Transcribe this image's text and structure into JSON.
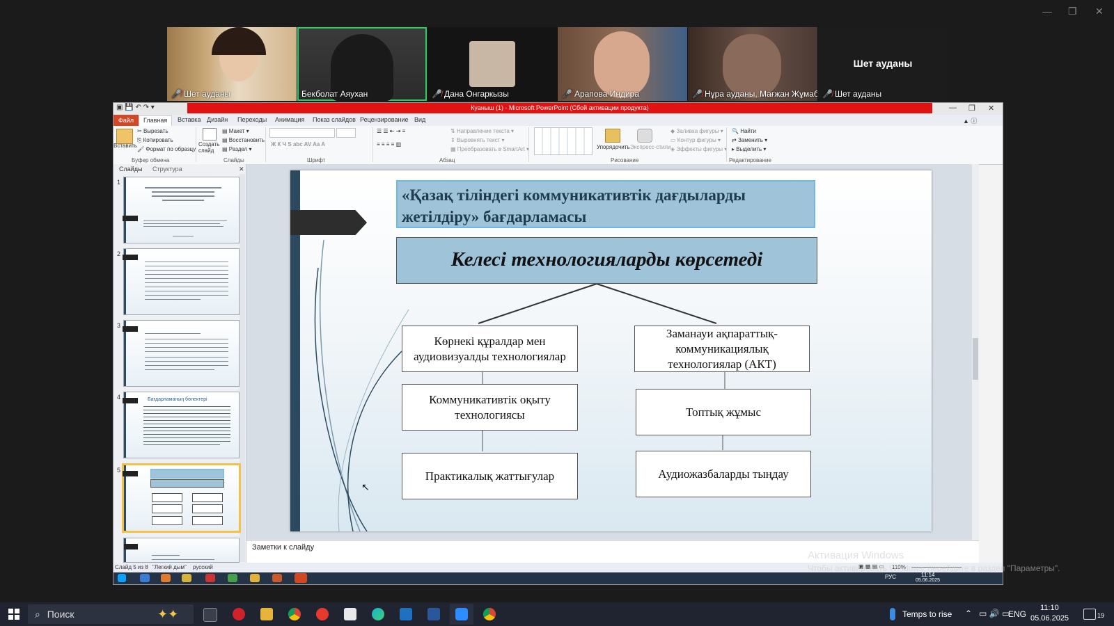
{
  "zoom_strip": {
    "participants": [
      {
        "name": "Шет ауданы",
        "muted": true
      },
      {
        "name": "Бекболат Аяухан",
        "muted": false
      },
      {
        "name": "Дана Онгаркызы",
        "muted": true
      },
      {
        "name": "Арапова Индира",
        "muted": true
      },
      {
        "name": "Нұра ауданы, Мағжан Жұмаба...",
        "muted": true
      },
      {
        "name": "Шет ауданы",
        "muted": true
      }
    ],
    "center_label": "Шет ауданы"
  },
  "ppt": {
    "title": "Куаныш (1) - Microsoft PowerPoint (Сбой активации продукта)",
    "tabs": [
      "Файл",
      "Главная",
      "Вставка",
      "Дизайн",
      "Переходы",
      "Анимация",
      "Показ слайдов",
      "Рецензирование",
      "Вид"
    ],
    "ribbon": {
      "paste": "Вставить",
      "cut": "Вырезать",
      "copy": "Копировать",
      "format_painter": "Формат по образцу",
      "clipboard": "Буфер обмена",
      "new_slide": "Создать слайд",
      "layout": "Макет",
      "reset": "Восстановить",
      "section": "Раздел",
      "slides": "Слайды",
      "font": "Шрифт",
      "paragraph": "Абзац",
      "text_direction": "Направление текста",
      "align_text": "Выровнять текст",
      "smartart": "Преобразовать в SmartArt",
      "arrange": "Упорядочить",
      "quick_styles": "Экспресс-стили",
      "shape_fill": "Заливка фигуры",
      "shape_outline": "Контур фигуры",
      "shape_effects": "Эффекты фигуры",
      "drawing": "Рисование",
      "find": "Найти",
      "replace": "Заменить",
      "select": "Выделить",
      "editing": "Редактирование"
    },
    "panel_tabs": [
      "Слайды",
      "Структура"
    ],
    "thumb_numbers": [
      "1",
      "2",
      "3",
      "4",
      "5",
      "6"
    ],
    "thumb4_title": "Бағдарламаның бөлектері",
    "slide": {
      "title": "«Қазақ тіліндегі коммуникативтік дағдыларды жетілдіру»  бағдарламасы",
      "subtitle": "Келесі технологияларды көрсетеді",
      "left_nodes": [
        "Көрнекі құралдар мен аудиовизуалды технологиялар",
        "Коммуникативтік оқыту технологиясы",
        "Практикалық жаттығулар"
      ],
      "right_nodes": [
        "Заманауи ақпараттық-коммуникациялық технологиялар (АКТ)",
        "Топтық жұмыс",
        "Аудиожазбаларды тыңдау"
      ]
    },
    "notes_placeholder": "Заметки к слайду",
    "status": {
      "slide": "Слайд 5 из 8",
      "theme": "\"Легкий дым\"",
      "lang": "русский",
      "zoom": "110%"
    },
    "inner_clock": {
      "time": "11:14",
      "date": "05.06.2025",
      "lang": "РУС"
    }
  },
  "watermark": {
    "title": "Активация Windows",
    "text": "Чтобы активировать Windows, перейдите в раздел \"Параметры\"."
  },
  "taskbar": {
    "search_placeholder": "Поиск",
    "weather": "Temps to rise",
    "lang": "ENG",
    "time": "11:10",
    "date": "05.06.2025",
    "notifications": "19"
  }
}
